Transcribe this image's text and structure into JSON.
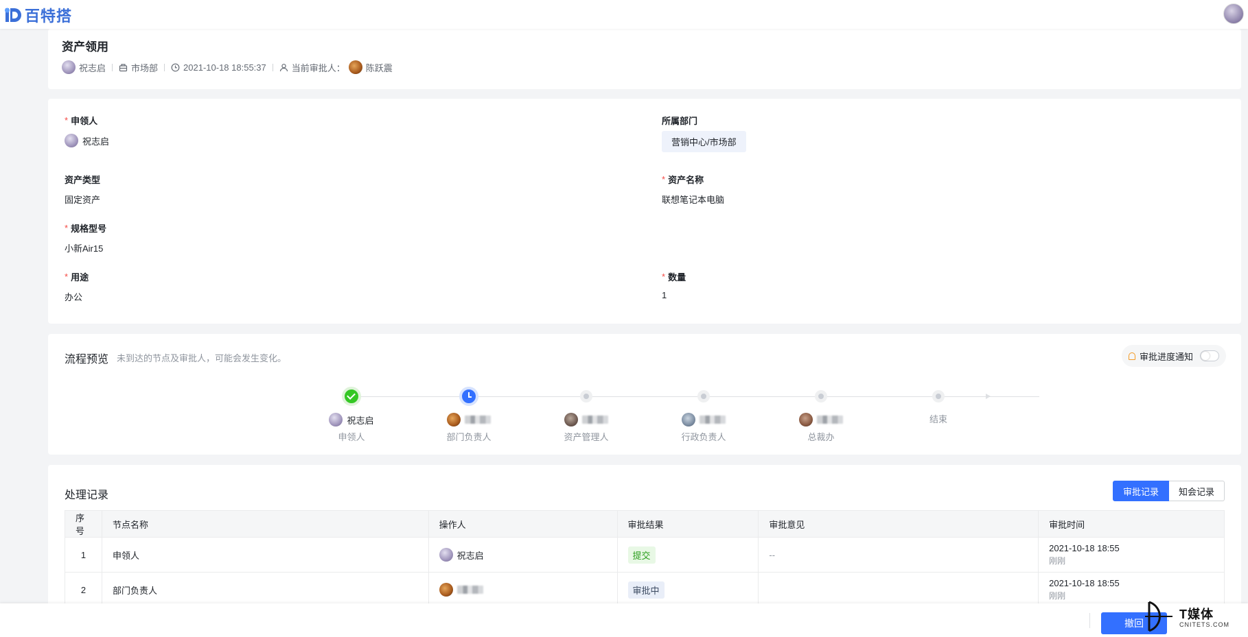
{
  "app": {
    "logo_text": "百特搭"
  },
  "header": {
    "title": "资产领用",
    "applicant": "祝志启",
    "department": "市场部",
    "datetime": "2021-10-18 18:55:37",
    "approver_label": "当前审批人：",
    "approver": "陈跃震"
  },
  "form": {
    "applicant": {
      "label": "申领人",
      "value": "祝志启"
    },
    "department": {
      "label": "所属部门",
      "value": "营销中心/市场部"
    },
    "asset_type": {
      "label": "资产类型",
      "value": "固定资产"
    },
    "asset_name": {
      "label": "资产名称",
      "value": "联想笔记本电脑"
    },
    "model": {
      "label": "规格型号",
      "value": "小新Air15"
    },
    "usage": {
      "label": "用途",
      "value": "办公"
    },
    "quantity": {
      "label": "数量",
      "value": "1"
    }
  },
  "flow": {
    "title": "流程预览",
    "hint": "未到达的节点及审批人，可能会发生变化。",
    "notify_label": "审批进度通知",
    "notify_on": false,
    "nodes": [
      {
        "name": "祝志启",
        "role": "申领人",
        "status": "done"
      },
      {
        "name": "",
        "role": "部门负责人",
        "status": "current"
      },
      {
        "name": "",
        "role": "资产管理人",
        "status": "waiting"
      },
      {
        "name": "",
        "role": "行政负责人",
        "status": "waiting"
      },
      {
        "name": "",
        "role": "总裁办",
        "status": "waiting"
      },
      {
        "name": "",
        "role": "结束",
        "status": "end"
      }
    ]
  },
  "records": {
    "title": "处理记录",
    "tab_approval": "审批记录",
    "tab_cc": "知会记录",
    "columns": [
      "序号",
      "节点名称",
      "操作人",
      "审批结果",
      "审批意见",
      "审批时间"
    ],
    "rows": [
      {
        "no": "1",
        "node": "申领人",
        "operator": "祝志启",
        "result": "提交",
        "opinion": "--",
        "time": "2021-10-18 18:55",
        "time_sub": "刚刚"
      },
      {
        "no": "2",
        "node": "部门负责人",
        "operator": "",
        "result": "审批中",
        "opinion": "",
        "time": "2021-10-18 18:55",
        "time_sub": "刚刚"
      }
    ]
  },
  "footer": {
    "withdraw_label": "撤回"
  },
  "watermark": {
    "text": "T媒体",
    "sub": "CNITETS.COM"
  },
  "colors": {
    "primary": "#3370ff",
    "success": "#34c724",
    "required": "#f54a45",
    "logo": "#3b6fd8"
  }
}
